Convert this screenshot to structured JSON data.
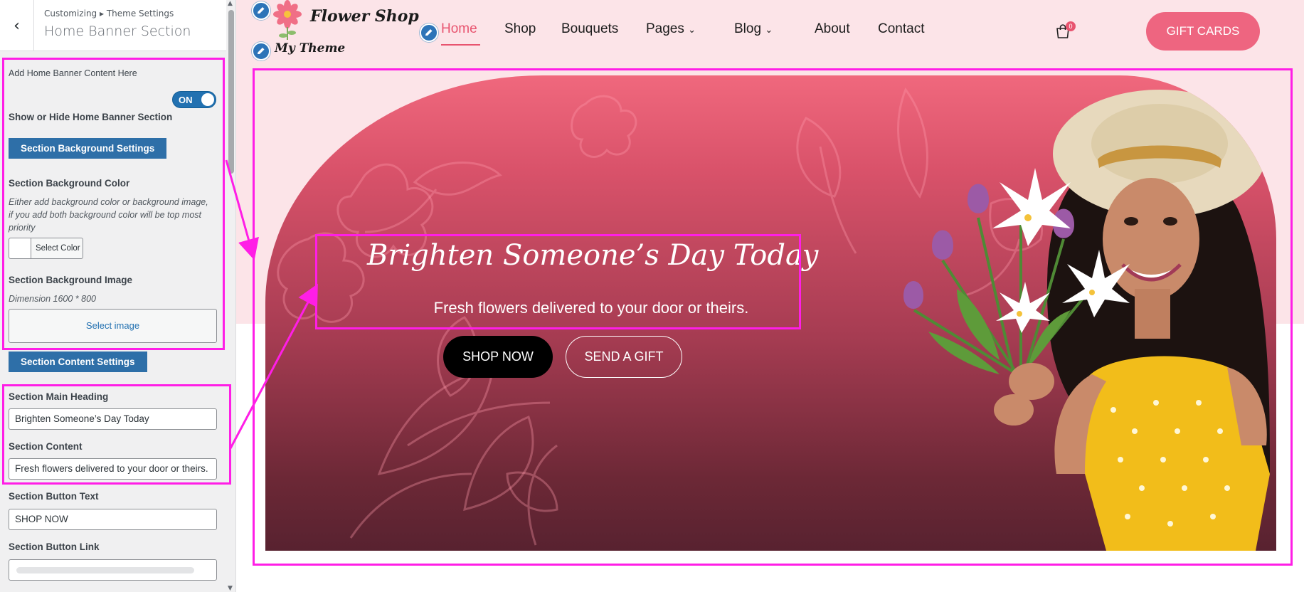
{
  "sidebar": {
    "breadcrumb": "Customizing ▸ Theme Settings",
    "title": "Home Banner Section",
    "add_content_label": "Add Home Banner Content Here",
    "toggle_label": "ON",
    "show_hide_label": "Show or Hide Home Banner Section",
    "bg_settings_button": "Section Background Settings",
    "bg_color_label": "Section Background Color",
    "bg_color_desc": "Either add background color or background image, if you add both background color will be top most priority",
    "select_color_label": "Select Color",
    "bg_image_label": "Section Background Image",
    "bg_image_dimension": "Dimension 1600 * 800",
    "select_image_label": "Select image",
    "content_settings_button": "Section Content Settings",
    "main_heading_label": "Section Main Heading",
    "main_heading_value": "Brighten Someone’s Day Today",
    "content_label": "Section Content",
    "content_value": "Fresh flowers delivered to your door or theirs.",
    "button_text_label": "Section Button Text",
    "button_text_value": "SHOP NOW",
    "button_link_label": "Section Button Link",
    "button_link_value": ""
  },
  "preview": {
    "logo_text": "Flower Shop",
    "tagline": "My Theme",
    "nav": [
      "Home",
      "Shop",
      "Bouquets",
      "Pages",
      "Blog",
      "About",
      "Contact"
    ],
    "cart_count": "0",
    "gift_cards_button": "GIFT CARDS",
    "banner_heading": "Brighten Someone’s Day Today",
    "banner_text": "Fresh flowers delivered to your door or theirs.",
    "shop_now_button": "SHOP NOW",
    "send_gift_button": "SEND A GIFT"
  },
  "colors": {
    "accent": "#ee6580",
    "admin_blue": "#2e6fa8",
    "annotation": "#ff1ee6",
    "banner_top": "#f0687d",
    "banner_bottom": "#582230"
  },
  "icons": [
    "back-chevron-icon",
    "edit-pencil-icon",
    "chevron-down-icon",
    "shopping-bag-icon",
    "flower-logo-icon"
  ]
}
